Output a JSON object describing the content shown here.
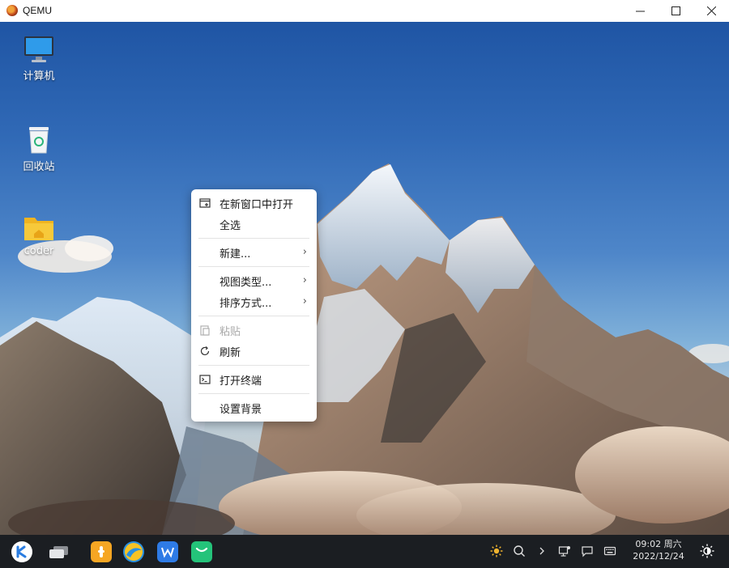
{
  "window": {
    "title": "QEMU",
    "controls": [
      "minimize-icon",
      "maximize-icon",
      "close-icon"
    ]
  },
  "desktop": {
    "icons": [
      {
        "label": "计算机",
        "icon": "computer-icon"
      },
      {
        "label": "回收站",
        "icon": "trash-icon"
      },
      {
        "label": "coder",
        "icon": "home-folder-icon"
      }
    ]
  },
  "context_menu": {
    "items": [
      {
        "label": "在新窗口中打开",
        "icon": "new-window-icon"
      },
      {
        "label": "全选"
      },
      {
        "label": "新建...",
        "submenu": true
      },
      {
        "label": "视图类型...",
        "submenu": true
      },
      {
        "label": "排序方式...",
        "submenu": true
      },
      {
        "label": "粘贴",
        "icon": "paste-icon",
        "disabled": true
      },
      {
        "label": "刷新",
        "icon": "refresh-icon"
      },
      {
        "label": "打开终端",
        "icon": "terminal-icon"
      },
      {
        "label": "设置背景"
      }
    ],
    "submenu_arrow": "›"
  },
  "taskbar": {
    "apps": [
      "start-menu-icon",
      "multitask-view-icon",
      "app-store-icon",
      "browser-icon",
      "wps-office-icon",
      "chat-app-icon"
    ],
    "tray": [
      "brightness-icon",
      "search-icon",
      "expand-tray-icon",
      "network-icon",
      "notification-icon",
      "keyboard-icon"
    ],
    "time": "09:02 周六",
    "date": "2022/12/24",
    "theme_toggle": "theme-toggle-icon"
  },
  "colors": {
    "taskbar_bg": "#1b1e22",
    "sky_top": "#1f55a4",
    "menu_bg": "#ffffff",
    "disabled_text": "#a8a8a8"
  }
}
